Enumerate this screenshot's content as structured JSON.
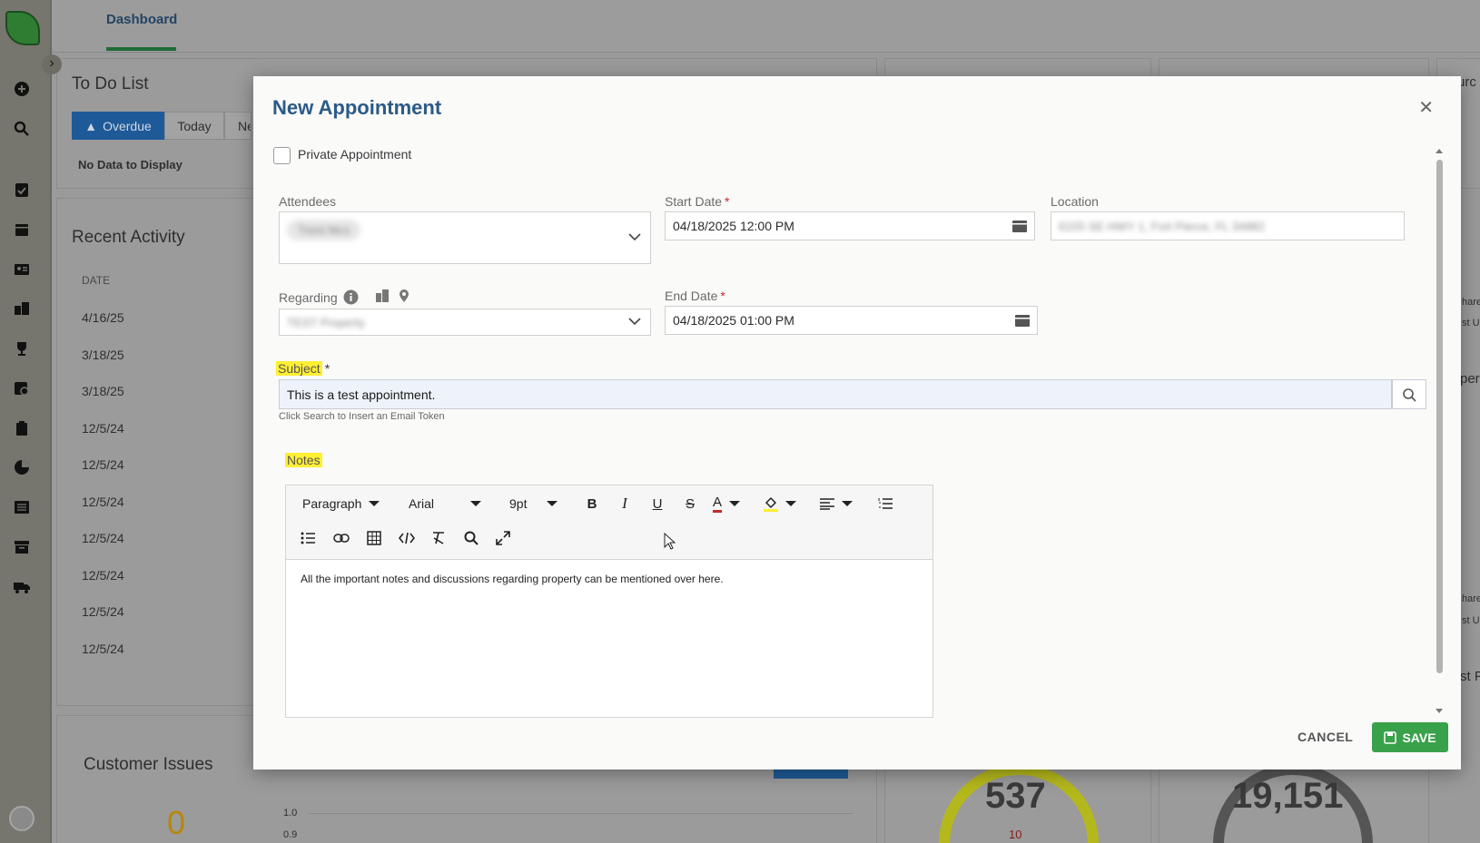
{
  "header": {
    "dashboard_tab": "Dashboard"
  },
  "todo": {
    "title": "To Do List",
    "tabs": [
      "Overdue",
      "Today",
      "Ne"
    ],
    "empty": "No Data to Display"
  },
  "recent": {
    "title": "Recent Activity",
    "date_header": "DATE",
    "dates": [
      "4/16/25",
      "3/18/25",
      "3/18/25",
      "12/5/24",
      "12/5/24",
      "12/5/24",
      "12/5/24",
      "12/5/24",
      "12/5/24",
      "12/5/24"
    ]
  },
  "issues": {
    "title": "Customer Issues",
    "count": "0",
    "axis": [
      "1.0",
      "0.9"
    ]
  },
  "stats": {
    "gauge1_value": "537",
    "gauge1_sub": "10",
    "gauge2_value": "19,151"
  },
  "right_fragments": [
    "urc",
    "hare",
    "st U",
    "per",
    "hare",
    "st U",
    "st F"
  ],
  "modal": {
    "title": "New Appointment",
    "private_label": "Private Appointment",
    "attendees_label": "Attendees",
    "attendee_chip": "Trent Mcs",
    "start_label": "Start Date",
    "start_value": "04/18/2025 12:00 PM",
    "location_label": "Location",
    "location_value": "6155 SE HWY 1, Fort Pierce, FL 34982",
    "regarding_label": "Regarding",
    "regarding_value": "TEST Property",
    "end_label": "End Date",
    "end_value": "04/18/2025 01:00 PM",
    "subject_label": "Subject",
    "subject_value": "This is a test appointment.",
    "subject_hint": "Click Search to Insert an Email Token",
    "notes_label": "Notes",
    "toolbar": {
      "paragraph": "Paragraph",
      "font": "Arial",
      "size": "9pt"
    },
    "notes_text": "All the important notes and discussions regarding property can be mentioned over here.",
    "cancel": "CANCEL",
    "save": "SAVE",
    "required_mark": "*"
  },
  "colors": {
    "brand_green": "#3aa14b",
    "title_blue": "#2b5a86",
    "highlight": "#ffef33",
    "overdue_tab": "#1f5a98"
  }
}
